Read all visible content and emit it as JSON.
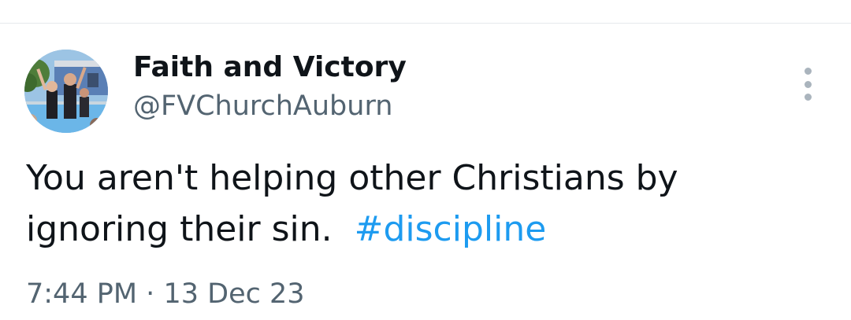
{
  "tweet": {
    "author": {
      "display_name": "Faith and Victory",
      "handle": "@FVChurchAuburn",
      "avatar_icon": "profile-photo-avatar"
    },
    "more_icon": "more-vertical-icon",
    "text": {
      "line1": "You aren't helping other Christians by",
      "line2": "ignoring their sin.",
      "hashtag": "#discipline"
    },
    "timestamp": {
      "time": "7:44 PM",
      "separator": "·",
      "date": "13 Dec 23"
    },
    "colors": {
      "text": "#0f1419",
      "secondary": "#536471",
      "link": "#1d9bf0",
      "divider": "#e6e9ec"
    }
  }
}
